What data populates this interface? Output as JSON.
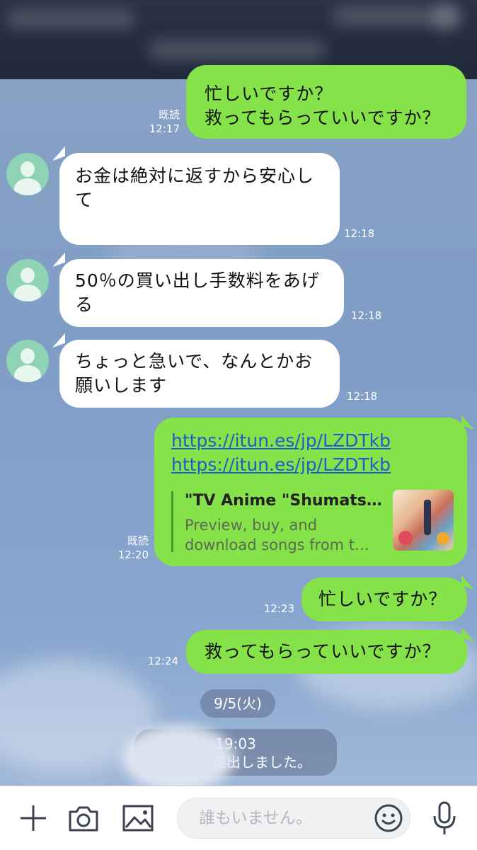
{
  "messages": [
    {
      "dir": "out",
      "lines": [
        "忙しいですか？",
        "救ってもらっていいですか？"
      ],
      "read": "既読",
      "time": "12:17"
    },
    {
      "dir": "in",
      "lines": [
        "お金は絶対に返すから安心し",
        "て"
      ],
      "time": "12:18"
    },
    {
      "dir": "in",
      "lines": [
        "50％の買い出し手数料をあげ",
        "る"
      ],
      "time": "12:18"
    },
    {
      "dir": "in",
      "lines": [
        "ちょっと急いで、なんとかお",
        "願いします"
      ],
      "time": "12:18"
    },
    {
      "dir": "out",
      "links": [
        "https://itun.es/jp/LZDTkb",
        "https://itun.es/jp/LZDTkb"
      ],
      "preview_title": "\"TV Anime \"Shumats…",
      "preview_desc": [
        "Preview, buy, and",
        "download songs from t…"
      ],
      "read": "既読",
      "time": "12:20"
    },
    {
      "dir": "out",
      "lines": [
        "忙しいですか？"
      ],
      "time": "12:23"
    },
    {
      "dir": "out",
      "lines": [
        "救ってもらっていいですか？"
      ],
      "time": "12:24"
    }
  ],
  "date_separator": "9/5(火)",
  "system_message": {
    "time": "19:03",
    "text": "退出しました。"
  },
  "input": {
    "placeholder": "誰もいません。"
  },
  "colors": {
    "outgoing_bubble": "#85e249",
    "incoming_bubble": "#ffffff",
    "link": "#1f5ec9"
  },
  "icons": [
    "plus-icon",
    "camera-icon",
    "image-icon",
    "emoji-icon",
    "microphone-icon"
  ]
}
